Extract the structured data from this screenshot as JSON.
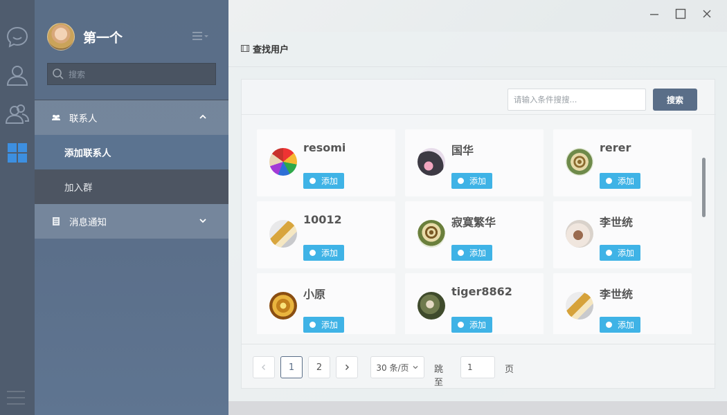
{
  "profile": {
    "name": "第一个"
  },
  "sidebar": {
    "search_placeholder": "搜索",
    "groups": [
      {
        "label": "联系人",
        "expanded": true,
        "items": [
          {
            "label": "添加联系人",
            "active": true
          },
          {
            "label": "加入群",
            "active": false
          }
        ]
      },
      {
        "label": "消息通知",
        "expanded": false,
        "items": []
      }
    ]
  },
  "main": {
    "title": "查找用户",
    "search": {
      "placeholder": "请输入条件搜搜...",
      "button": "搜索"
    },
    "users": [
      {
        "name": "resomi",
        "button": "添加",
        "avatar": "pencils"
      },
      {
        "name": "国华",
        "button": "添加",
        "avatar": "flower"
      },
      {
        "name": "rerer",
        "button": "添加",
        "avatar": "coffee"
      },
      {
        "name": "10012",
        "button": "添加",
        "avatar": "cake"
      },
      {
        "name": "寂寞繁华",
        "button": "添加",
        "avatar": "coffee"
      },
      {
        "name": "李世统",
        "button": "添加",
        "avatar": "bowl"
      },
      {
        "name": "小原",
        "button": "添加",
        "avatar": "gold"
      },
      {
        "name": "tiger8862",
        "button": "添加",
        "avatar": "bird"
      },
      {
        "name": "李世统",
        "button": "添加",
        "avatar": "cake"
      }
    ],
    "pagination": {
      "pages": [
        "1",
        "2"
      ],
      "current": "1",
      "page_size": "30 条/页",
      "jump_label": "跳至",
      "jump_value": "1",
      "page_unit": "页"
    }
  },
  "colors": {
    "sidebar": "#5b6f8a",
    "rail": "#4f5c6e",
    "accent": "#5a6e88",
    "add_button": "#3fb3e6"
  }
}
